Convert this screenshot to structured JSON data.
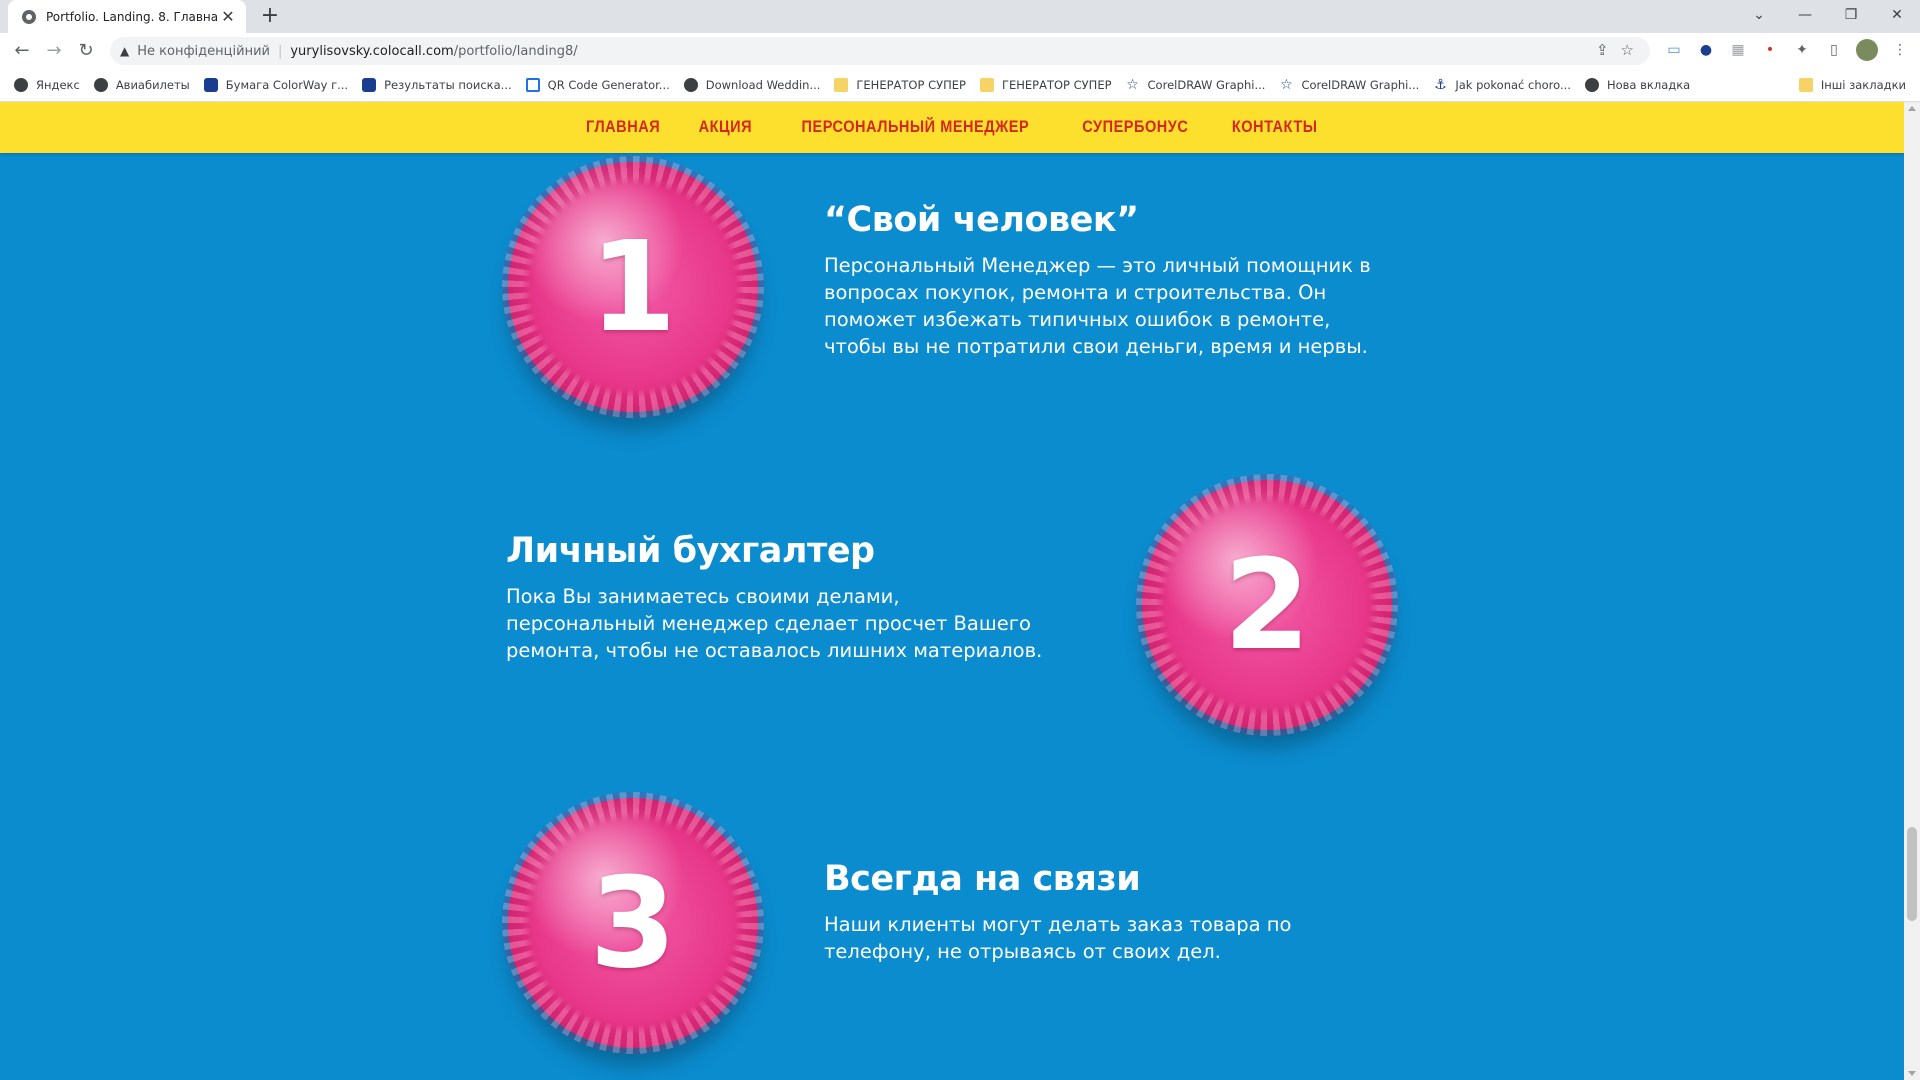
{
  "browser": {
    "tab_title": "Portfolio. Landing. 8. Главная",
    "tab_close": "✕",
    "new_tab": "+",
    "window_controls": [
      "⌄",
      "—",
      "❐",
      "✕"
    ],
    "back": "←",
    "forward": "→",
    "reload": "↻",
    "security_icon": "▲",
    "security_text": "Не конфіденційний",
    "url_host": "yurylisovsky.colocall.com",
    "url_path": "/portfolio/landing8/",
    "bookmarks": [
      {
        "label": "Яндекс",
        "icon": "globe-icon"
      },
      {
        "label": "Авиабилеты",
        "icon": "globe-icon"
      },
      {
        "label": "Бумага ColorWay г...",
        "icon": "colorway-icon"
      },
      {
        "label": "Результаты поиска...",
        "icon": "colorway-icon"
      },
      {
        "label": "QR Code Generator...",
        "icon": "qr-icon"
      },
      {
        "label": "Download Weddin...",
        "icon": "globe-icon"
      },
      {
        "label": "ГЕНЕРАТОР СУПЕР",
        "icon": "folder-icon"
      },
      {
        "label": "ГЕНЕРАТОР СУПЕР",
        "icon": "folder-icon"
      },
      {
        "label": "CorelDRAW Graphi...",
        "icon": "star-icon"
      },
      {
        "label": "CorelDRAW Graphi...",
        "icon": "star-icon"
      },
      {
        "label": "Jak pokonać choro...",
        "icon": "anchor-icon"
      },
      {
        "label": "Нова вкладка",
        "icon": "globe-icon"
      }
    ],
    "other_bookmarks": "Інші закладки"
  },
  "nav": {
    "items": [
      "ГЛАВНАЯ",
      "АКЦИЯ",
      "ПЕРСОНАЛЬНЫЙ МЕНЕДЖЕР",
      "СУПЕРБОНУС",
      "КОНТАКТЫ"
    ]
  },
  "features": [
    {
      "number": "1",
      "title": "“Свой человек”",
      "text": "Персональный Менеджер — это личный помощник в вопросах покупок, ремонта и строительства. Он поможет избежать типичных ошибок в ремонте, чтобы вы не потратили свои деньги, время и нервы."
    },
    {
      "number": "2",
      "title": "Личный бухгалтер",
      "text": "Пока Вы занимаетесь своими делами, персональный менеджер сделает просчет Вашего ремонта, чтобы не оставалось лишних материалов."
    },
    {
      "number": "3",
      "title": "Всегда на связи",
      "text": "Наши клиенты могут делать заказ товара по телефону, не отрываясь от своих дел."
    }
  ],
  "colors": {
    "page_bg": "#0b8ccf",
    "nav_bg": "#fde02d",
    "nav_text": "#d6281a",
    "ball": "#e8378a"
  }
}
